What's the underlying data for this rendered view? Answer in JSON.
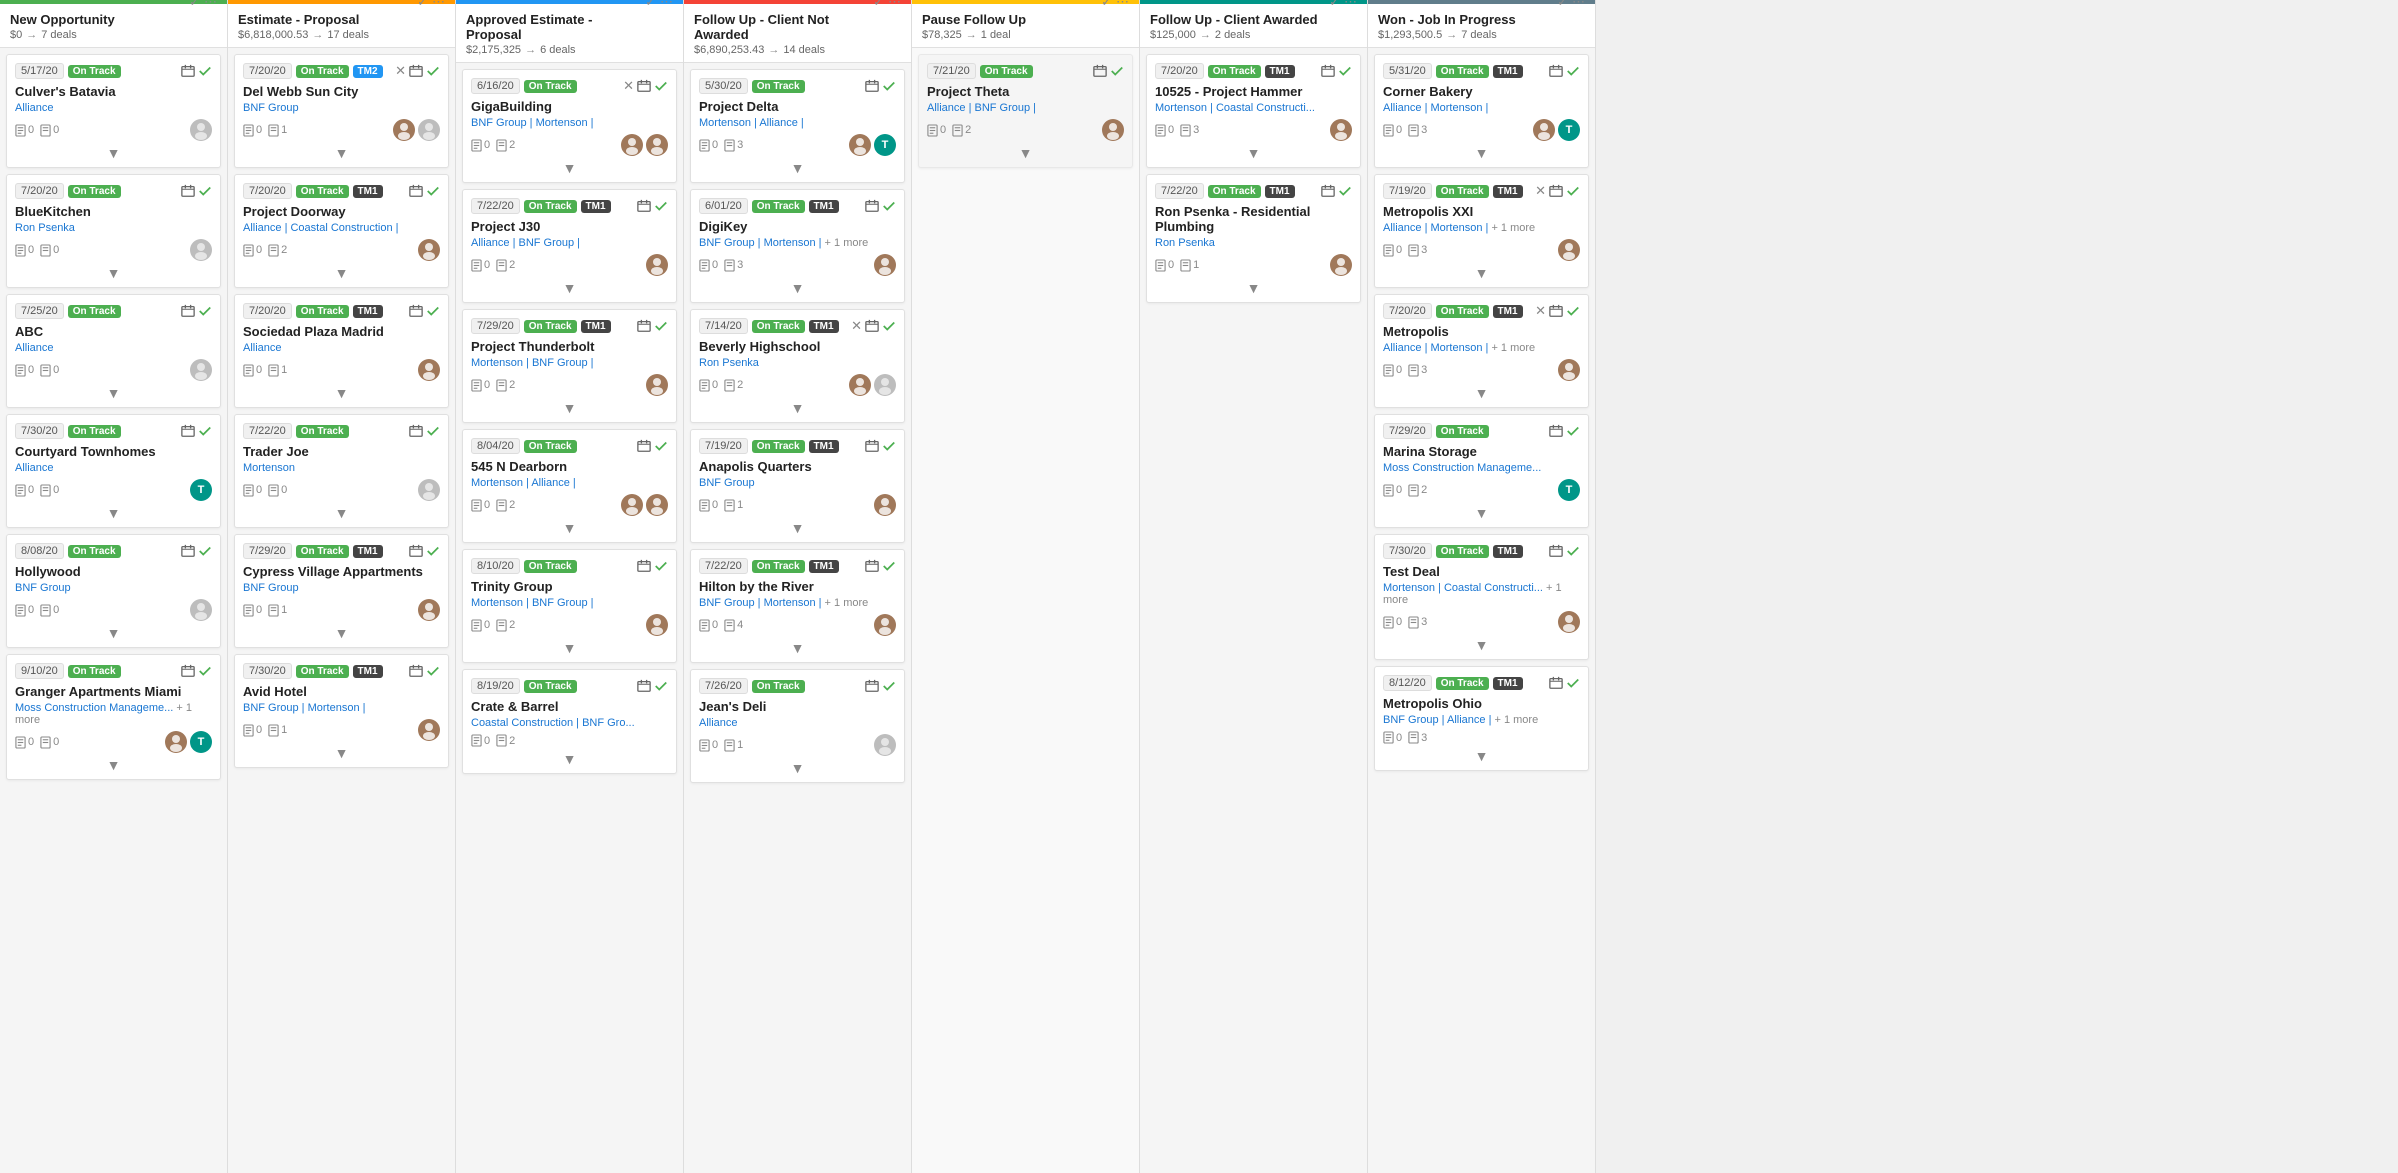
{
  "columns": [
    {
      "id": "new-opportunity",
      "title": "New Opportunity",
      "subtitle": "$0",
      "deals": "7 deals",
      "color": "green",
      "cards": [
        {
          "date": "5/17/20",
          "badges": [
            "On Track"
          ],
          "badge_types": [
            "green"
          ],
          "title": "Culver's Batavia",
          "company": "Alliance",
          "doc_count": "0",
          "note_count": "0",
          "avatars": [
            "gray"
          ]
        },
        {
          "date": "7/20/20",
          "badges": [
            "On Track"
          ],
          "badge_types": [
            "green"
          ],
          "title": "BlueKitchen",
          "company": "Ron Psenka",
          "doc_count": "0",
          "note_count": "0",
          "avatars": [
            "gray"
          ]
        },
        {
          "date": "7/25/20",
          "badges": [
            "On Track"
          ],
          "badge_types": [
            "green"
          ],
          "title": "ABC",
          "company": "Alliance",
          "doc_count": "0",
          "note_count": "0",
          "avatars": [
            "gray"
          ]
        },
        {
          "date": "7/30/20",
          "badges": [
            "On Track"
          ],
          "badge_types": [
            "green"
          ],
          "title": "Courtyard Townhomes",
          "company": "Alliance",
          "doc_count": "0",
          "note_count": "0",
          "avatars": [
            "teal"
          ]
        },
        {
          "date": "8/08/20",
          "badges": [
            "On Track"
          ],
          "badge_types": [
            "green"
          ],
          "title": "Hollywood",
          "company": "BNF Group",
          "doc_count": "0",
          "note_count": "0",
          "avatars": [
            "gray"
          ]
        },
        {
          "date": "9/10/20",
          "badges": [
            "On Track"
          ],
          "badge_types": [
            "green"
          ],
          "title": "Granger Apartments Miami",
          "company": "Moss Construction Manageme...",
          "company_more": "+ 1 more",
          "doc_count": "0",
          "note_count": "0",
          "avatars": [
            "brown",
            "teal"
          ]
        }
      ]
    },
    {
      "id": "estimate-proposal",
      "title": "Estimate - Proposal",
      "subtitle": "$6,818,000.53",
      "deals": "17 deals",
      "color": "orange",
      "cards": [
        {
          "date": "7/20/20",
          "badges": [
            "On Track",
            "TM2"
          ],
          "badge_types": [
            "green",
            "blue"
          ],
          "has_x": true,
          "title": "Del Webb Sun City",
          "company": "BNF Group",
          "doc_count": "0",
          "note_count": "1",
          "avatars": [
            "brown",
            "gray"
          ]
        },
        {
          "date": "7/20/20",
          "badges": [
            "On Track",
            "TM1"
          ],
          "badge_types": [
            "green",
            "dark"
          ],
          "title": "Project Doorway",
          "company": "Alliance | Coastal Construction |",
          "doc_count": "0",
          "note_count": "2",
          "avatars": [
            "brown"
          ]
        },
        {
          "date": "7/20/20",
          "badges": [
            "On Track",
            "TM1"
          ],
          "badge_types": [
            "green",
            "dark"
          ],
          "title": "Sociedad Plaza Madrid",
          "company": "Alliance",
          "doc_count": "0",
          "note_count": "1",
          "avatars": [
            "brown"
          ]
        },
        {
          "date": "7/22/20",
          "badges": [
            "On Track"
          ],
          "badge_types": [
            "green"
          ],
          "title": "Trader Joe",
          "company": "Mortenson",
          "doc_count": "0",
          "note_count": "0",
          "avatars": [
            "gray"
          ]
        },
        {
          "date": "7/29/20",
          "badges": [
            "On Track",
            "TM1"
          ],
          "badge_types": [
            "green",
            "dark"
          ],
          "title": "Cypress Village Appartments",
          "company": "BNF Group",
          "doc_count": "0",
          "note_count": "1",
          "avatars": [
            "brown"
          ]
        },
        {
          "date": "7/30/20",
          "badges": [
            "On Track",
            "TM1"
          ],
          "badge_types": [
            "green",
            "dark"
          ],
          "title": "Avid Hotel",
          "company": "BNF Group | Mortenson |",
          "doc_count": "0",
          "note_count": "1",
          "avatars": [
            "brown"
          ]
        }
      ]
    },
    {
      "id": "approved-estimate",
      "title": "Approved Estimate - Proposal",
      "subtitle": "$2,175,325",
      "deals": "6 deals",
      "color": "blue",
      "cards": [
        {
          "date": "6/16/20",
          "badges": [
            "On Track"
          ],
          "badge_types": [
            "green"
          ],
          "has_x": true,
          "title": "GigaBuilding",
          "company": "BNF Group | Mortenson |",
          "doc_count": "0",
          "note_count": "2",
          "avatars": [
            "brown",
            "brown"
          ]
        },
        {
          "date": "7/22/20",
          "badges": [
            "On Track",
            "TM1"
          ],
          "badge_types": [
            "green",
            "dark"
          ],
          "title": "Project J30",
          "company": "Alliance | BNF Group |",
          "doc_count": "0",
          "note_count": "2",
          "avatars": [
            "brown"
          ]
        },
        {
          "date": "7/29/20",
          "badges": [
            "On Track",
            "TM1"
          ],
          "badge_types": [
            "green",
            "dark"
          ],
          "title": "Project Thunderbolt",
          "company": "Mortenson | BNF Group |",
          "doc_count": "0",
          "note_count": "2",
          "avatars": [
            "brown"
          ]
        },
        {
          "date": "8/04/20",
          "badges": [
            "On Track"
          ],
          "badge_types": [
            "green"
          ],
          "title": "545 N Dearborn",
          "company": "Mortenson | Alliance |",
          "doc_count": "0",
          "note_count": "2",
          "avatars": [
            "brown",
            "brown"
          ]
        },
        {
          "date": "8/10/20",
          "badges": [
            "On Track"
          ],
          "badge_types": [
            "green"
          ],
          "title": "Trinity Group",
          "company": "Mortenson | BNF Group |",
          "doc_count": "0",
          "note_count": "2",
          "avatars": [
            "brown"
          ]
        },
        {
          "date": "8/19/20",
          "badges": [
            "On Track"
          ],
          "badge_types": [
            "green"
          ],
          "title": "Crate & Barrel",
          "company": "Coastal Construction | BNF Gro...",
          "doc_count": "0",
          "note_count": "2",
          "avatars": []
        }
      ]
    },
    {
      "id": "follow-up-not-awarded",
      "title": "Follow Up - Client Not Awarded",
      "subtitle": "$6,890,253.43",
      "deals": "14 deals",
      "color": "red",
      "cards": [
        {
          "date": "5/30/20",
          "badges": [
            "On Track"
          ],
          "badge_types": [
            "green"
          ],
          "title": "Project Delta",
          "company": "Mortenson | Alliance |",
          "doc_count": "0",
          "note_count": "3",
          "avatars": [
            "brown",
            "teal"
          ]
        },
        {
          "date": "6/01/20",
          "badges": [
            "On Track",
            "TM1"
          ],
          "badge_types": [
            "green",
            "dark"
          ],
          "title": "DigiKey",
          "company": "BNF Group | Mortenson |",
          "company_more": "+ 1 more",
          "doc_count": "0",
          "note_count": "3",
          "avatars": [
            "brown"
          ]
        },
        {
          "date": "7/14/20",
          "badges": [
            "On Track",
            "TM1"
          ],
          "badge_types": [
            "green",
            "dark"
          ],
          "has_x": true,
          "title": "Beverly Highschool",
          "company": "Ron Psenka",
          "doc_count": "0",
          "note_count": "2",
          "avatars": [
            "brown",
            "gray"
          ]
        },
        {
          "date": "7/19/20",
          "badges": [
            "On Track",
            "TM1"
          ],
          "badge_types": [
            "green",
            "dark"
          ],
          "title": "Anapolis Quarters",
          "company": "BNF Group",
          "doc_count": "0",
          "note_count": "1",
          "avatars": [
            "brown"
          ]
        },
        {
          "date": "7/22/20",
          "badges": [
            "On Track",
            "TM1"
          ],
          "badge_types": [
            "green",
            "dark"
          ],
          "title": "Hilton by the River",
          "company": "BNF Group | Mortenson |",
          "company_more": "+ 1 more",
          "doc_count": "0",
          "note_count": "4",
          "avatars": [
            "brown"
          ]
        },
        {
          "date": "7/26/20",
          "badges": [
            "On Track"
          ],
          "badge_types": [
            "green"
          ],
          "title": "Jean's Deli",
          "company": "Alliance",
          "doc_count": "0",
          "note_count": "1",
          "avatars": [
            "gray"
          ]
        }
      ]
    },
    {
      "id": "pause-follow-up",
      "title": "Pause Follow Up",
      "subtitle": "$78,325",
      "deals": "1 deal",
      "color": "yellow",
      "grayed": true,
      "cards": [
        {
          "date": "7/21/20",
          "badges": [
            "On Track"
          ],
          "badge_types": [
            "green"
          ],
          "title": "Project Theta",
          "company": "Alliance | BNF Group |",
          "doc_count": "0",
          "note_count": "2",
          "avatars": [
            "brown"
          ]
        }
      ]
    },
    {
      "id": "follow-up-awarded",
      "title": "Follow Up - Client Awarded",
      "subtitle": "$125,000",
      "deals": "2 deals",
      "color": "teal",
      "cards": [
        {
          "date": "7/20/20",
          "badges": [
            "On Track",
            "TM1"
          ],
          "badge_types": [
            "green",
            "dark"
          ],
          "title": "10525 - Project Hammer",
          "company": "Mortenson | Coastal Constructi...",
          "doc_count": "0",
          "note_count": "3",
          "avatars": [
            "brown"
          ]
        },
        {
          "date": "7/22/20",
          "badges": [
            "On Track",
            "TM1"
          ],
          "badge_types": [
            "green",
            "dark"
          ],
          "title": "Ron Psenka - Residential Plumbing",
          "company": "Ron Psenka",
          "doc_count": "0",
          "note_count": "1",
          "avatars": [
            "brown"
          ]
        }
      ]
    },
    {
      "id": "won-job-in-progress",
      "title": "Won - Job In Progress",
      "subtitle": "$1,293,500.5",
      "deals": "7 deals",
      "color": "dark",
      "cards": [
        {
          "date": "5/31/20",
          "badges": [
            "On Track",
            "TM1"
          ],
          "badge_types": [
            "green",
            "dark"
          ],
          "title": "Corner Bakery",
          "company": "Alliance | Mortenson |",
          "doc_count": "0",
          "note_count": "3",
          "avatars": [
            "brown",
            "teal"
          ]
        },
        {
          "date": "7/19/20",
          "badges": [
            "On Track",
            "TM1"
          ],
          "badge_types": [
            "green",
            "dark"
          ],
          "has_x": true,
          "title": "Metropolis XXI",
          "company": "Alliance | Mortenson |",
          "company_more": "+ 1 more",
          "doc_count": "0",
          "note_count": "3",
          "avatars": [
            "brown"
          ]
        },
        {
          "date": "7/20/20",
          "badges": [
            "On Track",
            "TM1"
          ],
          "badge_types": [
            "green",
            "dark"
          ],
          "has_x": true,
          "title": "Metropolis",
          "company": "Alliance | Mortenson |",
          "company_more": "+ 1 more",
          "doc_count": "0",
          "note_count": "3",
          "avatars": [
            "brown"
          ]
        },
        {
          "date": "7/29/20",
          "badges": [
            "On Track"
          ],
          "badge_types": [
            "green"
          ],
          "title": "Marina Storage",
          "company": "Moss Construction Manageme...",
          "doc_count": "0",
          "note_count": "2",
          "avatars": [
            "teal"
          ]
        },
        {
          "date": "7/30/20",
          "badges": [
            "On Track",
            "TM1"
          ],
          "badge_types": [
            "green",
            "dark"
          ],
          "title": "Test Deal",
          "company": "Mortenson | Coastal Constructi...",
          "company_more": "+ 1 more",
          "doc_count": "0",
          "note_count": "3",
          "avatars": [
            "brown"
          ]
        },
        {
          "date": "8/12/20",
          "badges": [
            "On Track",
            "TM1"
          ],
          "badge_types": [
            "green",
            "dark"
          ],
          "title": "Metropolis Ohio",
          "company": "BNF Group | Alliance |",
          "company_more": "+ 1 more",
          "doc_count": "0",
          "note_count": "3",
          "avatars": []
        }
      ]
    }
  ],
  "icons": {
    "calendar": "📅",
    "check": "✓",
    "more": "⋯",
    "expand": "▼",
    "doc": "📄",
    "note": "📋",
    "x": "✕"
  }
}
